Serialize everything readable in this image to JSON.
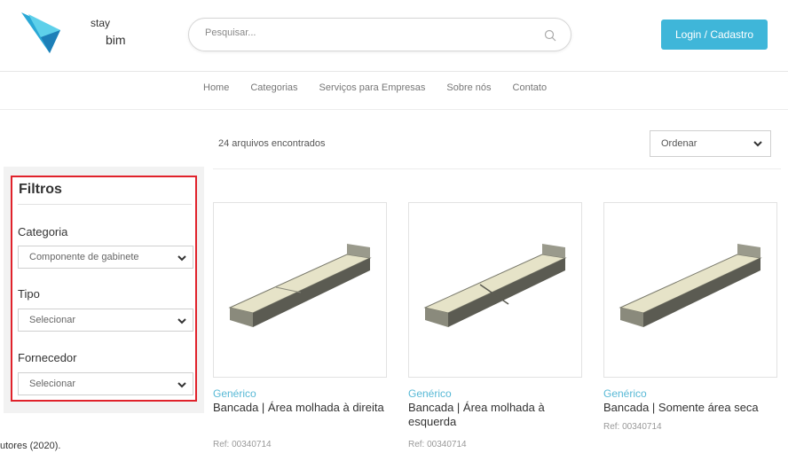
{
  "brand": {
    "logo_line1": "stay",
    "logo_line2": "bim",
    "accent": "#3fb6d9"
  },
  "search": {
    "placeholder": "Pesquisar..."
  },
  "header": {
    "login_label": "Login / Cadastro"
  },
  "nav": {
    "items": [
      "Home",
      "Categorias",
      "Serviços para Empresas",
      "Sobre nós",
      "Contato"
    ]
  },
  "results": {
    "count_text": "24 arquivos encontrados",
    "sort_label": "Ordenar"
  },
  "filters": {
    "title": "Filtros",
    "categoria": {
      "label": "Categoria",
      "value": "Componente de gabinete"
    },
    "tipo": {
      "label": "Tipo",
      "value": "Selecionar"
    },
    "fornecedor": {
      "label": "Fornecedor",
      "value": "Selecionar"
    }
  },
  "caption": "utores (2020).",
  "products": [
    {
      "brand": "Genérico",
      "title": "Bancada | Área molhada à direita",
      "ref": "Ref: 00340714"
    },
    {
      "brand": "Genérico",
      "title": "Bancada | Área molhada à esquerda",
      "ref": "Ref: 00340714"
    },
    {
      "brand": "Genérico",
      "title": "Bancada | Somente área seca",
      "ref": "Ref: 00340714"
    }
  ]
}
